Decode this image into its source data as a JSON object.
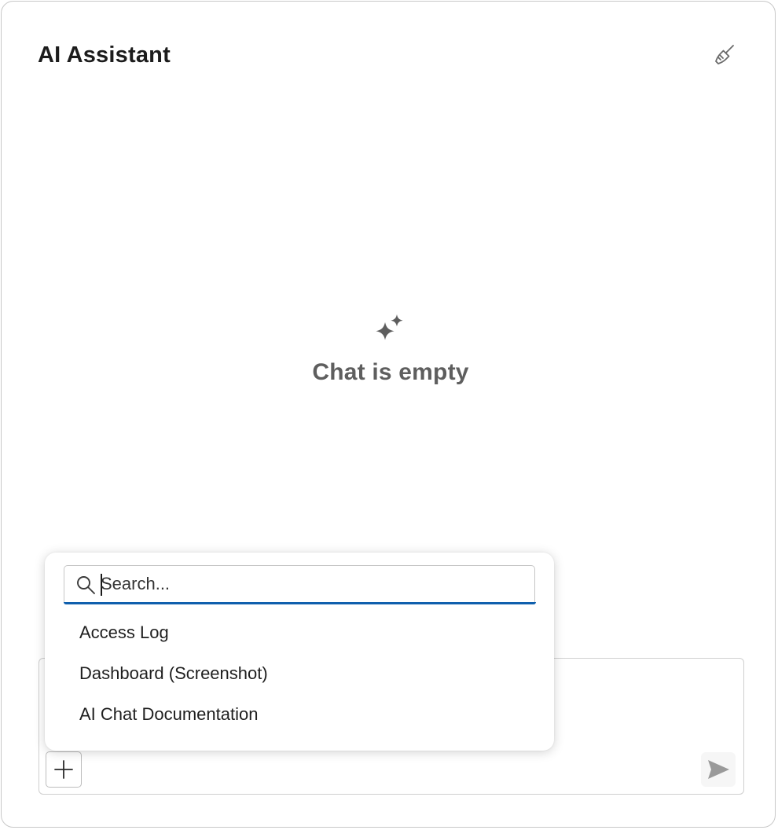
{
  "header": {
    "title": "AI Assistant",
    "clear_icon": "broom-icon"
  },
  "empty_state": {
    "icon": "sparkle-icon",
    "text": "Chat is empty"
  },
  "composer": {
    "add_icon": "plus-icon",
    "send_icon": "send-icon"
  },
  "attach_popup": {
    "search": {
      "placeholder": "Search...",
      "value": "",
      "icon": "search-icon"
    },
    "items": [
      {
        "label": "Access Log"
      },
      {
        "label": "Dashboard (Screenshot)"
      },
      {
        "label": "AI Chat Documentation"
      }
    ]
  },
  "colors": {
    "accent": "#0f5fad",
    "muted_text": "#5e5e5e",
    "border": "#c8c8c8"
  }
}
